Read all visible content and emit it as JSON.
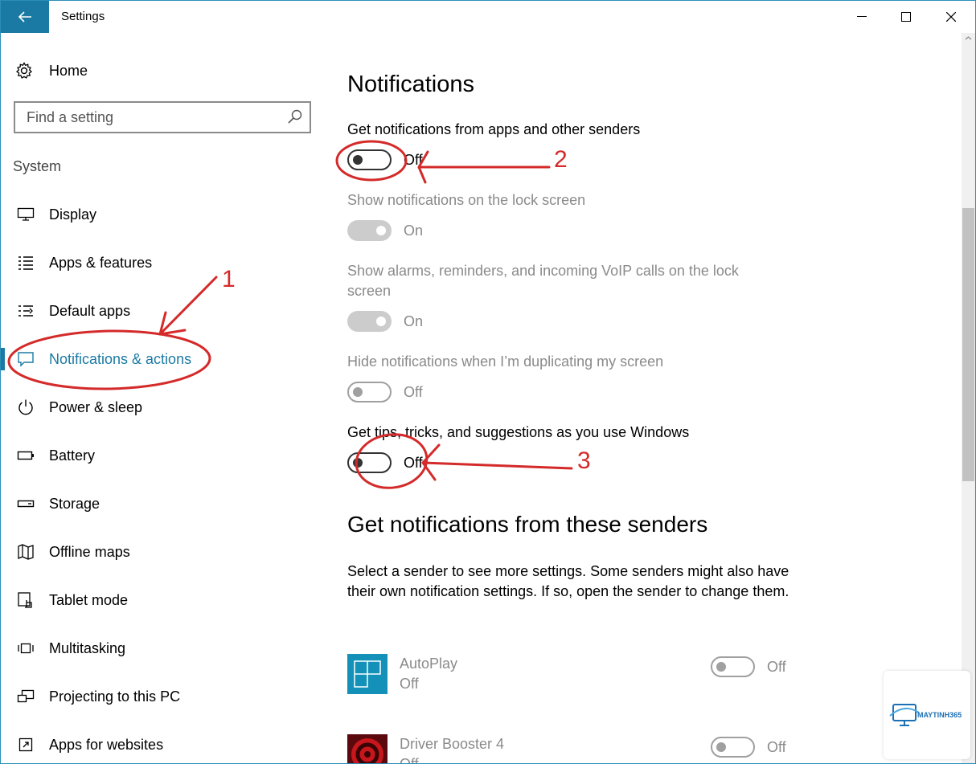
{
  "window": {
    "title": "Settings"
  },
  "sidebar": {
    "home_label": "Home",
    "search_placeholder": "Find a setting",
    "section_label": "System",
    "items": [
      {
        "label": "Display",
        "icon": "display-icon"
      },
      {
        "label": "Apps & features",
        "icon": "list-icon"
      },
      {
        "label": "Default apps",
        "icon": "default-apps-icon"
      },
      {
        "label": "Notifications & actions",
        "icon": "message-icon",
        "active": true
      },
      {
        "label": "Power & sleep",
        "icon": "power-icon"
      },
      {
        "label": "Battery",
        "icon": "battery-icon"
      },
      {
        "label": "Storage",
        "icon": "storage-icon"
      },
      {
        "label": "Offline maps",
        "icon": "map-icon"
      },
      {
        "label": "Tablet mode",
        "icon": "tablet-icon"
      },
      {
        "label": "Multitasking",
        "icon": "multitasking-icon"
      },
      {
        "label": "Projecting to this PC",
        "icon": "projecting-icon"
      },
      {
        "label": "Apps for websites",
        "icon": "open-external-icon"
      }
    ]
  },
  "main": {
    "heading": "Notifications",
    "settings": [
      {
        "title": "Get notifications from apps and other senders",
        "state": "Off"
      },
      {
        "title": "Show notifications on the lock screen",
        "state": "On"
      },
      {
        "title": "Show alarms, reminders, and incoming VoIP calls on the lock screen",
        "state": "On"
      },
      {
        "title": "Hide notifications when I’m duplicating my screen",
        "state": "Off"
      },
      {
        "title": "Get tips, tricks, and suggestions as you use Windows",
        "state": "Off"
      }
    ],
    "senders_heading": "Get notifications from these senders",
    "senders_description": "Select a sender to see more settings. Some senders might also have their own notification settings. If so, open the sender to change them.",
    "senders": [
      {
        "name": "AutoPlay",
        "status": "Off",
        "toggle_state": "Off",
        "icon_color": "#1391b8"
      },
      {
        "name": "Driver Booster 4",
        "status": "Off",
        "toggle_state": "Off",
        "icon_color": "#c8161d"
      }
    ]
  },
  "annotations": {
    "marker_1": "1",
    "marker_2": "2",
    "marker_3": "3",
    "color": "#d42a2a"
  },
  "watermark": {
    "brand": "MAYTINH365"
  },
  "colors": {
    "accent": "#1b7aa3"
  }
}
